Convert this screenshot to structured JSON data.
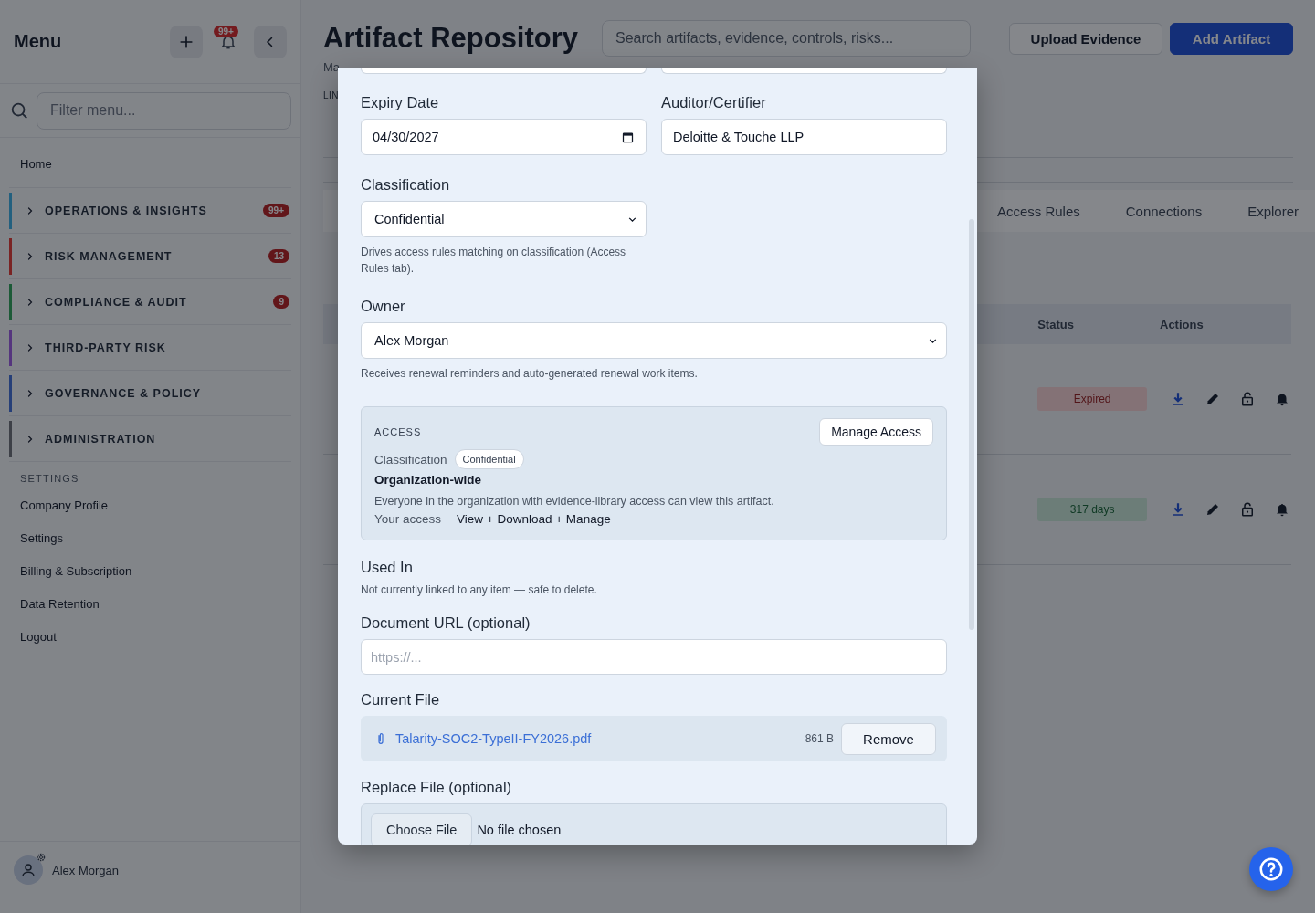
{
  "sidebar": {
    "title": "Menu",
    "notification_count": "99+",
    "filter_placeholder": "Filter menu...",
    "home": "Home",
    "groups": [
      {
        "label": "OPERATIONS & INSIGHTS",
        "badge": "99+",
        "color": "#23607f",
        "expanded": false
      },
      {
        "label": "RISK MANAGEMENT",
        "badge": "13",
        "color": "#7a2323",
        "expanded": false
      },
      {
        "label": "COMPLIANCE & AUDIT",
        "badge": "9",
        "color": "#1c5a37",
        "expanded": false
      },
      {
        "label": "THIRD-PARTY RISK",
        "color": "#55357e",
        "expanded": false
      },
      {
        "label": "GOVERNANCE & POLICY",
        "color": "#263f78",
        "expanded": false
      },
      {
        "label": "ADMINISTRATION",
        "color": "#3d4047",
        "expanded": false
      }
    ],
    "settings_heading": "SETTINGS",
    "settings_items": [
      "Company Profile",
      "Settings",
      "Billing & Subscription",
      "Data Retention",
      "Logout"
    ],
    "user": {
      "name": "Alex Morgan"
    }
  },
  "header": {
    "title": "Artifact Repository",
    "subtitle": "Ma",
    "search_placeholder": "Search artifacts, evidence, controls, risks...",
    "buttons": [
      "Upload Evidence",
      "Add Artifact"
    ],
    "filter_label": "LIN"
  },
  "tabs": [
    {
      "label": "Access Rules",
      "selected": false
    },
    {
      "label": "Connections",
      "selected": false
    },
    {
      "label": "Explorer",
      "selected": false
    }
  ],
  "table": {
    "columns": [
      "Status",
      "Actions"
    ],
    "rows": [
      {
        "status": "Expired",
        "kind": "expired"
      },
      {
        "status": "317 days",
        "kind": "valid"
      }
    ]
  },
  "modal": {
    "expiry_date": {
      "label": "Expiry Date",
      "value": "04/30/2027"
    },
    "auditor": {
      "label": "Auditor/Certifier",
      "value": "Deloitte & Touche LLP"
    },
    "classification": {
      "label": "Classification",
      "value": "Confidential",
      "help": "Drives access rules matching on classification (Access Rules tab)."
    },
    "owner": {
      "label": "Owner",
      "value": "Alex Morgan",
      "help": "Receives renewal reminders and auto-generated renewal work items."
    },
    "access": {
      "heading": "ACCESS",
      "button": "Manage Access",
      "classification_label": "Classification",
      "classification_value": "Confidential",
      "scope": "Organization-wide",
      "description": "Everyone in the organization with evidence-library access can view this artifact.",
      "your_access_label": "Your access",
      "your_access_value": "View + Download + Manage"
    },
    "used_in": {
      "label": "Used In",
      "text": "Not currently linked to any item — safe to delete."
    },
    "document_url": {
      "label": "Document URL (optional)",
      "placeholder": "https://..."
    },
    "current_file": {
      "label": "Current File",
      "name": "Talarity-SOC2-TypeII-FY2026.pdf",
      "size": "861 B",
      "button": "Remove"
    },
    "replace_file": {
      "label": "Replace File (optional)",
      "button": "Choose File",
      "status": "No file chosen"
    }
  }
}
